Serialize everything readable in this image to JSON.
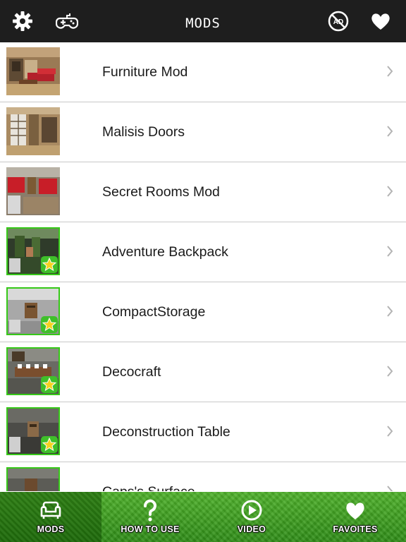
{
  "header": {
    "title": "MODS",
    "icons": [
      "gear-icon",
      "gamepad-icon",
      "no-ads-icon",
      "heart-icon"
    ],
    "background_color": "#1e1e1e"
  },
  "list": {
    "items": [
      {
        "label": "Furniture Mod",
        "favorite": false,
        "thumb": "furniture"
      },
      {
        "label": "Malisis Doors",
        "favorite": false,
        "thumb": "doors"
      },
      {
        "label": "Secret Rooms Mod",
        "favorite": false,
        "thumb": "rooms"
      },
      {
        "label": "Adventure Backpack",
        "favorite": true,
        "thumb": "forest"
      },
      {
        "label": "CompactStorage",
        "favorite": true,
        "thumb": "storage"
      },
      {
        "label": "Decocraft",
        "favorite": true,
        "thumb": "deco"
      },
      {
        "label": "Deconstruction Table",
        "favorite": true,
        "thumb": "table"
      },
      {
        "label": "Caps's Surface",
        "favorite": true,
        "thumb": "surface"
      }
    ],
    "favorite_border_color": "#36c818",
    "star_color": "#f5d21e"
  },
  "tabs": [
    {
      "label": "MODS",
      "icon": "sofa-icon",
      "active": true
    },
    {
      "label": "HOW TO USE",
      "icon": "question-icon",
      "active": false
    },
    {
      "label": "VIDEO",
      "icon": "play-icon",
      "active": false
    },
    {
      "label": "FAVOITES",
      "icon": "heart-icon",
      "active": false
    }
  ],
  "tabbar_color": "#3f9f22"
}
